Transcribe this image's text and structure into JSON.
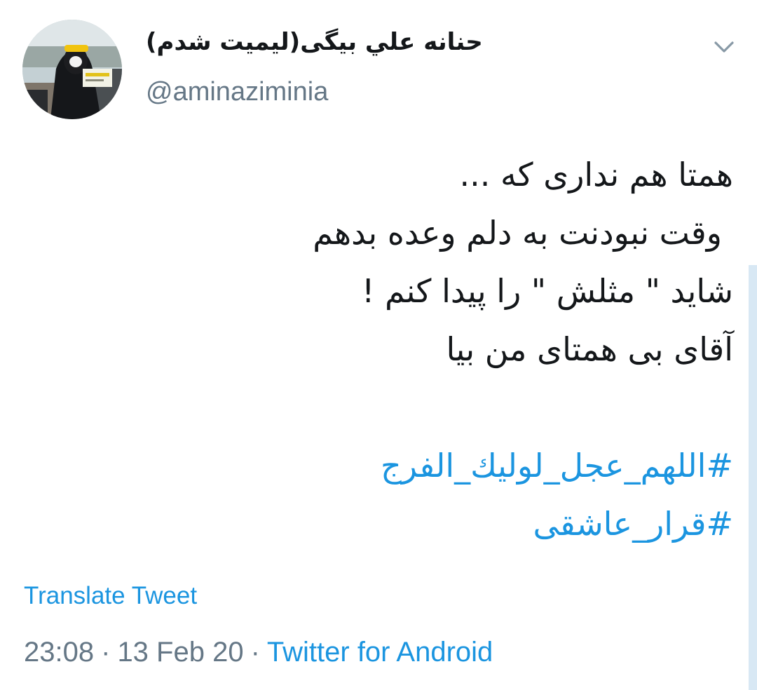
{
  "tweet": {
    "display_name": "حنانه علي بيگی(ليميت شدم)",
    "handle": "@aminaziminia",
    "avatar_icon": "profile-photo",
    "menu_icon": "chevron-down-icon",
    "lines": [
      "همتا هم نداری که ...",
      "وقت نبودنت به دلم وعده بدهم",
      "شاید \" مثلش \" را پیدا کنم !",
      "آقای بی همتای من بیا"
    ],
    "hashtags": [
      "#اللهم_عجل_لوليك_الفرج",
      "#قرار_عاشقی"
    ],
    "translate_label": "Translate Tweet",
    "time": "23:08",
    "date": "13 Feb 20",
    "separator": "·",
    "source": "Twitter for Android"
  },
  "colors": {
    "link": "#1b95e0",
    "secondary_text": "#657786",
    "primary_text": "#14171a",
    "scrollbar": "#d8e8f4"
  }
}
